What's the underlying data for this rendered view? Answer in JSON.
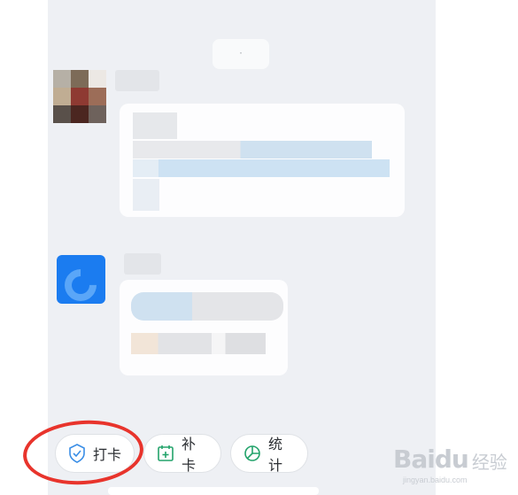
{
  "chat": {
    "time_label": "·"
  },
  "quick_actions": [
    {
      "label": "打卡",
      "icon": "location-check-icon"
    },
    {
      "label": "补卡",
      "icon": "calendar-add-icon"
    },
    {
      "label": "统计",
      "icon": "pie-chart-icon"
    }
  ],
  "watermark": {
    "logo": "Baidu",
    "sub": "经验",
    "url": "jingyan.baidu.com"
  },
  "colors": {
    "accent_green": "#23a36b",
    "icon_blue": "#3a8ee6",
    "highlight_red": "#e8342c",
    "app_blue": "#1b7cf0"
  }
}
